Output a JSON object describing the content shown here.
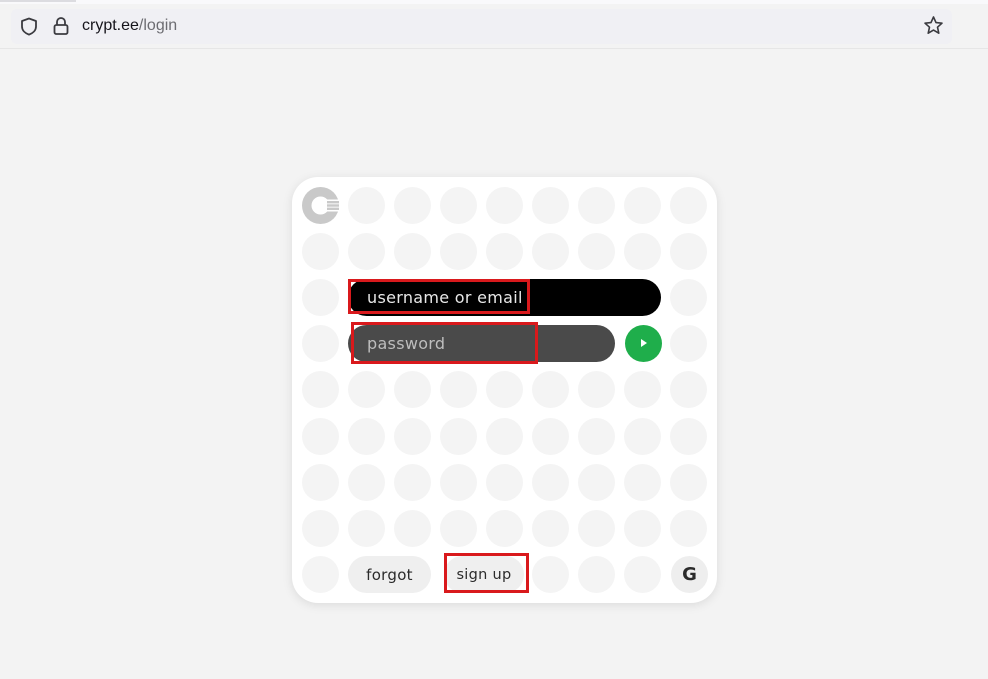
{
  "browser": {
    "url_host": "crypt.ee",
    "url_path": "/login",
    "icons": {
      "shield": "shield-icon",
      "lock": "lock-icon",
      "bookmark": "star-icon"
    }
  },
  "login": {
    "logo": "cryptee-logo-icon",
    "username_placeholder": "username or email",
    "password_placeholder": "password",
    "forgot_label": "forgot",
    "signup_label": "sign up",
    "google_label": "G",
    "submit_icon": "play-arrow-icon"
  },
  "colors": {
    "username_bg": "#000000",
    "password_bg": "#4a4a4a",
    "submit_green": "#1fae4b",
    "highlight_red": "#d9191c",
    "page_bg": "#f3f3f3",
    "dot_grey": "#f4f4f4"
  }
}
